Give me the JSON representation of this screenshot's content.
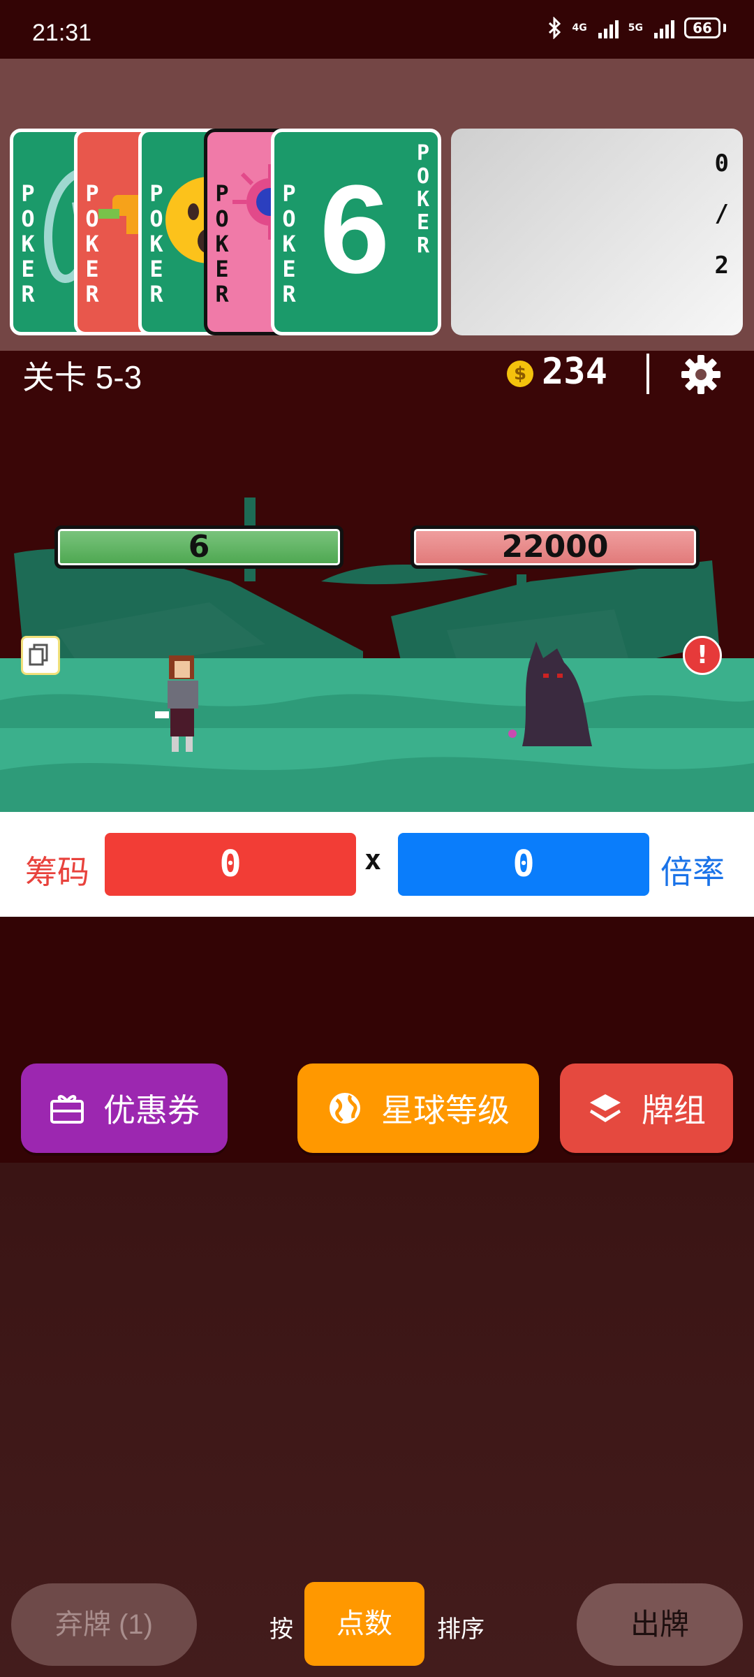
{
  "status_bar": {
    "time": "21:31",
    "net1": "4G",
    "net2": "5G",
    "battery": "66"
  },
  "hand": {
    "card_brand": "POKER",
    "card_brand_vertical": "P\nO\nK\nE\nR",
    "top_card_value": "6",
    "top_card_side": "P\nO\nK\nE\nR"
  },
  "hand_info": {
    "current": "0",
    "separator": "/",
    "max": "2"
  },
  "header": {
    "level": "关卡 5-3",
    "coin_symbol": "$",
    "money": "234"
  },
  "battle": {
    "player_hp": "6",
    "enemy_hp": "22000",
    "alert_symbol": "!"
  },
  "score": {
    "chips_label": "筹码",
    "chips_value": "0",
    "times": "x",
    "mult_value": "0",
    "mult_label": "倍率"
  },
  "actions": {
    "coupon": "优惠券",
    "planet": "星球等级",
    "deck": "牌组"
  },
  "controls": {
    "discard": "弃牌 (1)",
    "sort_prefix": "按",
    "sort_mode": "点数",
    "sort_suffix": "排序",
    "play": "出牌"
  },
  "colors": {
    "bg": "#3a0607",
    "chips": "#f23d36",
    "mult": "#0a7dfb",
    "coupon": "#9c27b0",
    "planet": "#ff9800",
    "deck": "#e5493f"
  }
}
